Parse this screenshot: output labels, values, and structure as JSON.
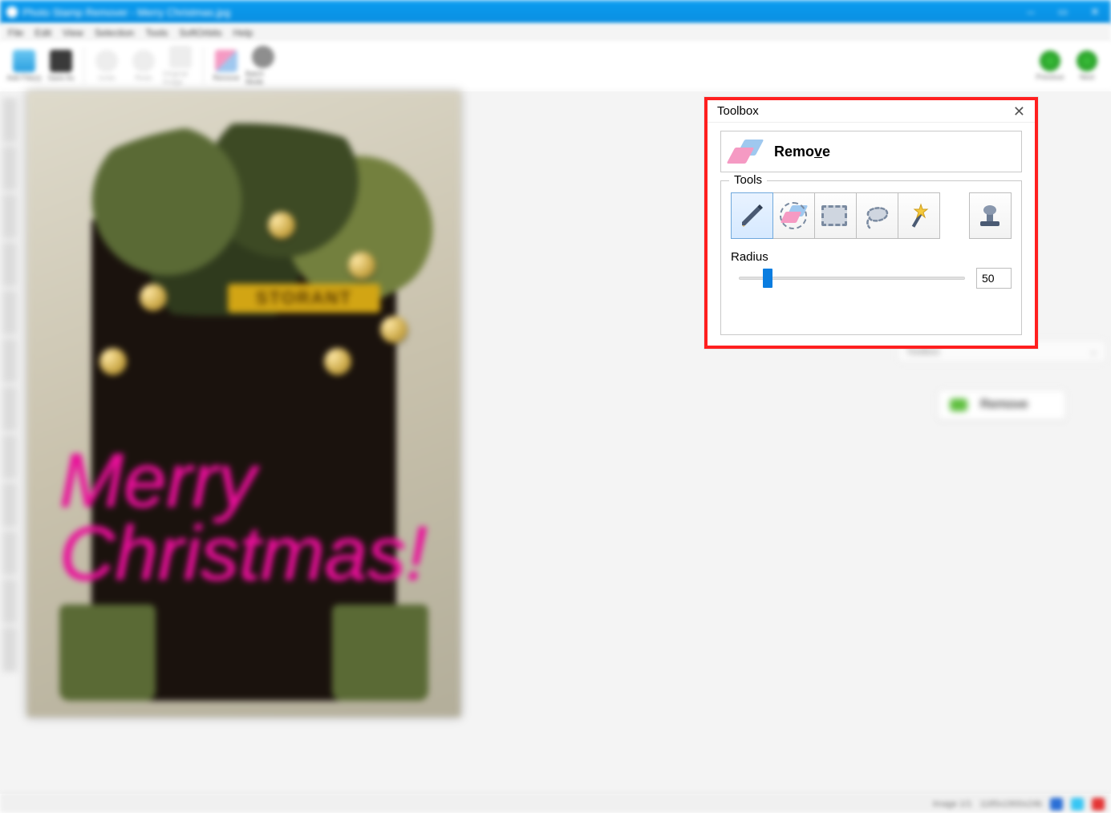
{
  "window": {
    "title": "Photo Stamp Remover - Merry Christmas.jpg"
  },
  "menu": {
    "items": [
      "File",
      "Edit",
      "View",
      "Selection",
      "Tools",
      "SoftOrbits",
      "Help"
    ]
  },
  "ribbon": {
    "add_file": "Add File(s)",
    "save_as": "Save As",
    "undo": "Undo",
    "redo": "Redo",
    "original": "Original Image",
    "remove": "Remove",
    "batch": "Batch Mode",
    "previous": "Previous",
    "next": "Next"
  },
  "canvas": {
    "sign_text": "STORANT",
    "watermark_line1": "Merry",
    "watermark_line2": "Christmas!"
  },
  "rightpanel": {
    "section_label": "Toolbox",
    "run_button": "Remove"
  },
  "toolbox": {
    "panel_title": "Toolbox",
    "mode_label_pre": "Remo",
    "mode_label_u": "v",
    "mode_label_post": "e",
    "tools_legend": "Tools",
    "tool_names": {
      "marker": "Marker",
      "eraser_select": "Eraser Select",
      "rect_select": "Rectangular Select",
      "lasso": "Free Select",
      "wand": "Magic Wand",
      "stamp": "Clone Stamp"
    },
    "radius_label": "Radius",
    "radius_value": "50"
  },
  "statusbar": {
    "status_left": "",
    "image_info": "Image 1/1",
    "dims": "1185x1900x24b"
  },
  "colors": {
    "title_blue": "#0a8ee0",
    "accent_blue": "#0a7de0",
    "callout_red": "#ff1f1f",
    "watermark_pink": "#ea0f9a",
    "run_green": "#5fbf3f"
  }
}
